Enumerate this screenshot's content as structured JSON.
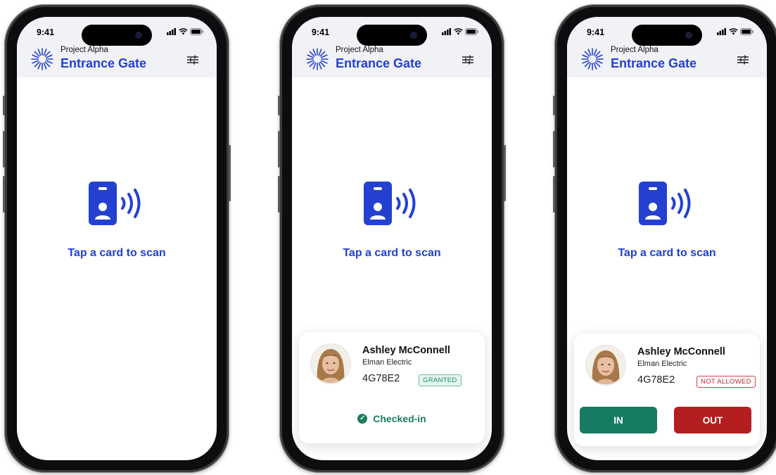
{
  "colors": {
    "brand_blue": "#2340d1",
    "header_bg": "#f1f2f6",
    "granted_green": "#1f8a6b",
    "checked_green": "#1a7d5e",
    "in_button": "#177a63",
    "out_button": "#b41e1e",
    "not_allowed_red": "#c0282d"
  },
  "phones": [
    {
      "status": {
        "time": "9:41"
      },
      "header": {
        "project": "Project Alpha",
        "title": "Entrance Gate",
        "logo_icon": "sunburst-logo-icon",
        "filter_icon": "sliders-icon"
      },
      "scan": {
        "icon": "nfc-card-icon",
        "prompt": "Tap a card to scan"
      }
    },
    {
      "status": {
        "time": "9:41"
      },
      "header": {
        "project": "Project Alpha",
        "title": "Entrance Gate"
      },
      "scan": {
        "prompt": "Tap a card to scan"
      },
      "result": {
        "name": "Ashley McConnell",
        "company": "Elman Electric",
        "id": "4G78E2",
        "badge": "GRANTED",
        "status": "Checked-in"
      }
    },
    {
      "status": {
        "time": "9:41"
      },
      "header": {
        "project": "Project Alpha",
        "title": "Entrance Gate"
      },
      "scan": {
        "prompt": "Tap a card to scan"
      },
      "result": {
        "name": "Ashley McConnell",
        "company": "Elman Electric",
        "id": "4G78E2",
        "badge": "NOT ALLOWED",
        "in_label": "IN",
        "out_label": "OUT"
      }
    }
  ]
}
